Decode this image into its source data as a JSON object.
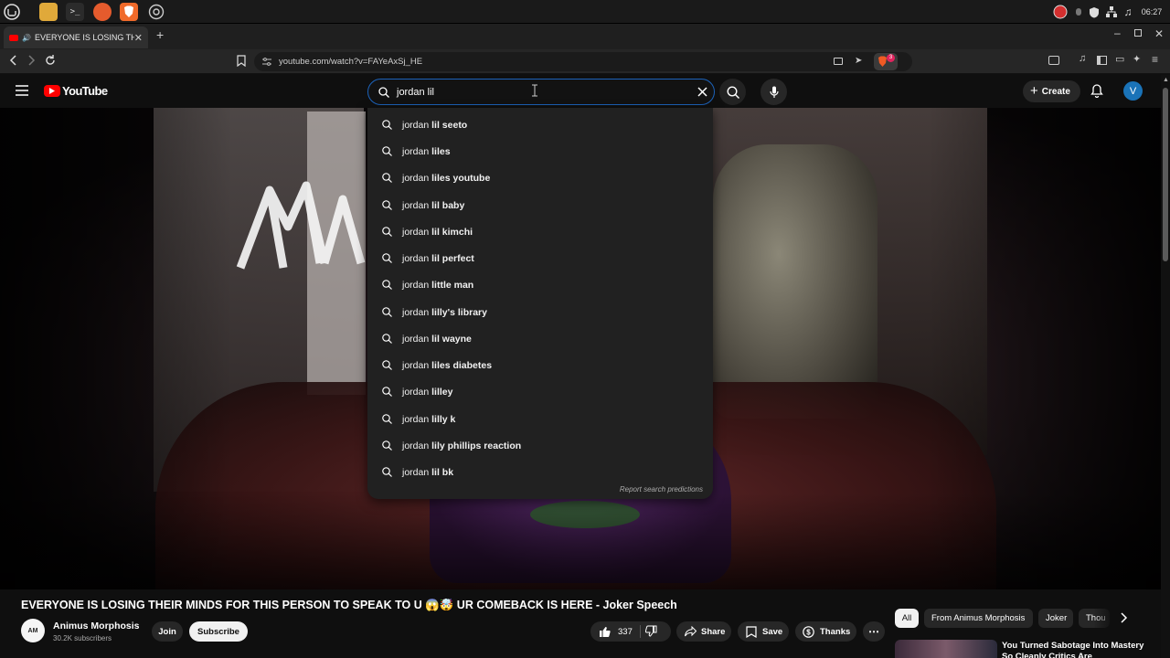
{
  "os": {
    "clock": "06:27",
    "apps": [
      "mint-menu",
      "files",
      "terminal",
      "firefox",
      "brave",
      "chromium"
    ]
  },
  "browser": {
    "tab_title": "EVERYONE IS LOSING THE",
    "url": "youtube.com/watch?v=FAYeAxSj_HE",
    "shield_badge": "3"
  },
  "youtube": {
    "logo_text": "YouTube",
    "search": {
      "query": "jordan lil",
      "suggestions": [
        {
          "prefix": "jordan",
          "rest": "lil seeto"
        },
        {
          "prefix": "jordan",
          "rest": "liles"
        },
        {
          "prefix": "jordan",
          "rest": "liles youtube"
        },
        {
          "prefix": "jordan",
          "rest": "lil baby"
        },
        {
          "prefix": "jordan",
          "rest": "lil kimchi"
        },
        {
          "prefix": "jordan",
          "rest": "lil perfect"
        },
        {
          "prefix": "jordan",
          "rest": "little man"
        },
        {
          "prefix": "jordan",
          "rest": "lilly's library"
        },
        {
          "prefix": "jordan",
          "rest": "lil wayne"
        },
        {
          "prefix": "jordan",
          "rest": "liles diabetes"
        },
        {
          "prefix": "jordan",
          "rest": "lilley"
        },
        {
          "prefix": "jordan",
          "rest": "lilly k"
        },
        {
          "prefix": "jordan",
          "rest": "lily phillips reaction"
        },
        {
          "prefix": "jordan",
          "rest": "lil bk"
        }
      ],
      "report_link": "Report search predictions"
    },
    "create_label": "Create",
    "avatar_letter": "V",
    "video": {
      "title": "EVERYONE IS LOSING THEIR MINDS FOR THIS PERSON TO SPEAK TO U 😱🤯 UR COMEBACK IS HERE - Joker Speech",
      "channel": "Animus Morphosis",
      "channel_avatar": "AM",
      "subscribers": "30.2K subscribers",
      "join_label": "Join",
      "subscribe_label": "Subscribe",
      "likes": "337",
      "share_label": "Share",
      "save_label": "Save",
      "thanks_label": "Thanks"
    },
    "chips": [
      "All",
      "From Animus Morphosis",
      "Joker",
      "Thou"
    ],
    "next_video_title": "You Turned Sabotage Into Mastery So Cleanly Critics Are"
  }
}
